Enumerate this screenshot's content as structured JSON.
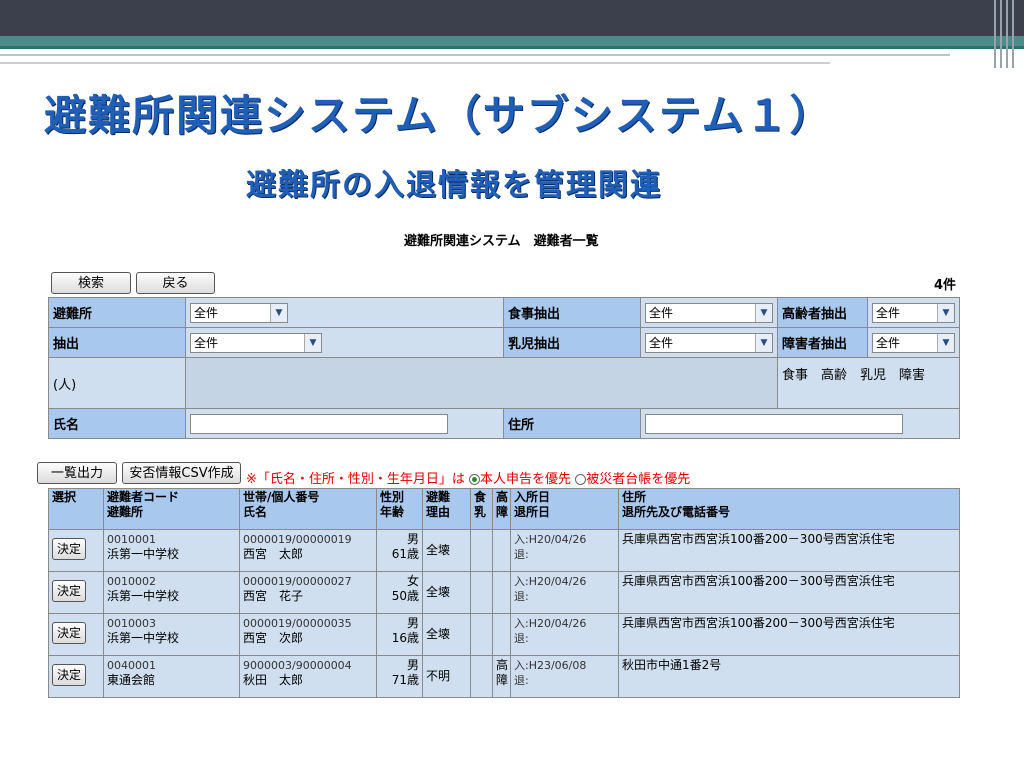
{
  "slide": {
    "title": "避難所関連システム（サブシステム１）",
    "subtitle": "避難所の入退情報を管理関連"
  },
  "window": {
    "title": "避難所関連システム　避難者一覧",
    "count": "4件"
  },
  "toolbar": {
    "search_label": "検索",
    "back_label": "戻る",
    "list_output_label": "一覧出力",
    "csv_label": "安否情報CSV作成"
  },
  "filters": {
    "shelter_label": "避難所",
    "shelter_value": "全件",
    "extract_label": "抽出",
    "extract_value": "全件",
    "food_label": "食事抽出",
    "food_value": "全件",
    "infant_label": "乳児抽出",
    "infant_value": "全件",
    "elderly_label": "高齢者抽出",
    "elderly_value": "全件",
    "disabled_label": "障害者抽出",
    "disabled_value": "全件",
    "people_label": "(人)",
    "people_text": "食事　高齢　乳児　障害",
    "name_label": "氏名",
    "address_label": "住所"
  },
  "note": {
    "text1": "※「氏名・住所・性別・生年月日」は",
    "opt1": "本人申告を優先",
    "opt2": "被災者台帳を優先"
  },
  "table": {
    "headers": {
      "select": "選択",
      "code1": "避難者コード",
      "code2": "避難所",
      "house1": "世帯/個人番号",
      "house2": "氏名",
      "sex1": "性別",
      "sex2": "年齢",
      "reason1": "避難",
      "reason2": "理由",
      "food1": "食",
      "food2": "乳",
      "high1": "高",
      "high2": "障",
      "in1": "入所日",
      "in2": "退所日",
      "addr1": "住所",
      "addr2": "退所先及び電話番号"
    },
    "rows": [
      {
        "btn": "決定",
        "code": "0010001",
        "shelter": "浜第一中学校",
        "hh": "0000019/00000019",
        "name": "西宮　太郎",
        "sex": "男",
        "age": "61歳",
        "reason": "全壊",
        "food": "",
        "high": "",
        "in": "入:H20/04/26",
        "out": "退:",
        "addr": "兵庫県西宮市西宮浜100番200－300号西宮浜住宅"
      },
      {
        "btn": "決定",
        "code": "0010002",
        "shelter": "浜第一中学校",
        "hh": "0000019/00000027",
        "name": "西宮　花子",
        "sex": "女",
        "age": "50歳",
        "reason": "全壊",
        "food": "",
        "high": "",
        "in": "入:H20/04/26",
        "out": "退:",
        "addr": "兵庫県西宮市西宮浜100番200－300号西宮浜住宅"
      },
      {
        "btn": "決定",
        "code": "0010003",
        "shelter": "浜第一中学校",
        "hh": "0000019/00000035",
        "name": "西宮　次郎",
        "sex": "男",
        "age": "16歳",
        "reason": "全壊",
        "food": "",
        "high": "",
        "in": "入:H20/04/26",
        "out": "退:",
        "addr": "兵庫県西宮市西宮浜100番200－300号西宮浜住宅"
      },
      {
        "btn": "決定",
        "code": "0040001",
        "shelter": "東通会館",
        "hh": "9000003/90000004",
        "name": "秋田　太郎",
        "sex": "男",
        "age": "71歳",
        "reason": "不明",
        "food": "",
        "high": "高\n障",
        "in": "入:H23/06/08",
        "out": "退:",
        "addr": "秋田市中通1番2号"
      }
    ]
  }
}
